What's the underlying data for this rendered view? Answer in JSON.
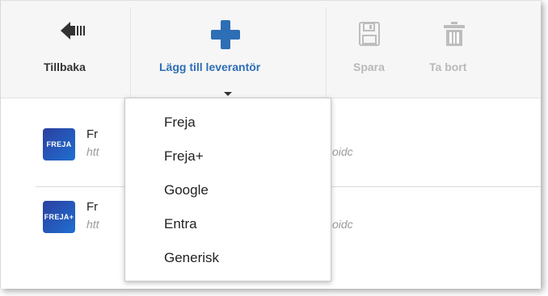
{
  "toolbar": {
    "back_label": "Tillbaka",
    "add_provider_label": "Lägg till leverantör",
    "save_label": "Spara",
    "delete_label": "Ta bort"
  },
  "providers": [
    {
      "logo_text": "FREJA",
      "title": "Fr",
      "url": "htt",
      "url_suffix": "oidc"
    },
    {
      "logo_text": "FREJA+",
      "title": "Fr",
      "url": "htt",
      "url_suffix": "oidc"
    }
  ],
  "dropdown": {
    "items": [
      "Freja",
      "Freja+",
      "Google",
      "Entra",
      "Generisk"
    ]
  },
  "colors": {
    "accent_blue": "#2e6eb5",
    "disabled_gray": "#b9b9b9",
    "logo_gradient_start": "#2c3fa0",
    "logo_gradient_end": "#1f6fd1"
  },
  "icons": {
    "back": "arrow-left-icon",
    "add": "plus-icon",
    "save": "floppy-disk-icon",
    "delete": "trash-icon"
  }
}
